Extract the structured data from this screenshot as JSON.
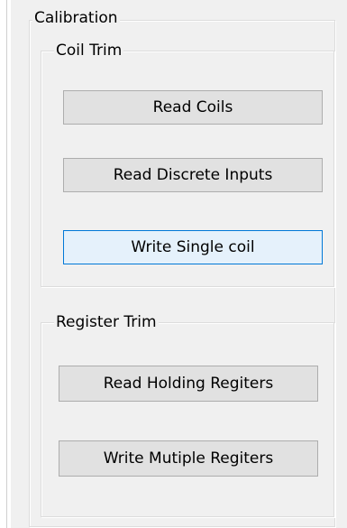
{
  "calibration": {
    "title": "Calibration",
    "coil_trim": {
      "title": "Coil Trim",
      "buttons": [
        "Read Coils",
        "Read Discrete Inputs",
        "Write Single coil"
      ]
    },
    "register_trim": {
      "title": "Register Trim",
      "buttons": [
        "Read Holding Regiters",
        "Write Mutiple Regiters"
      ]
    }
  },
  "colors": {
    "panel_bg": "#f0f0f0",
    "button_bg": "#e1e1e1",
    "button_border": "#adadad",
    "focus_border": "#0078d7",
    "focus_bg": "#e5f1fb",
    "group_border": "#dcdcdc"
  }
}
